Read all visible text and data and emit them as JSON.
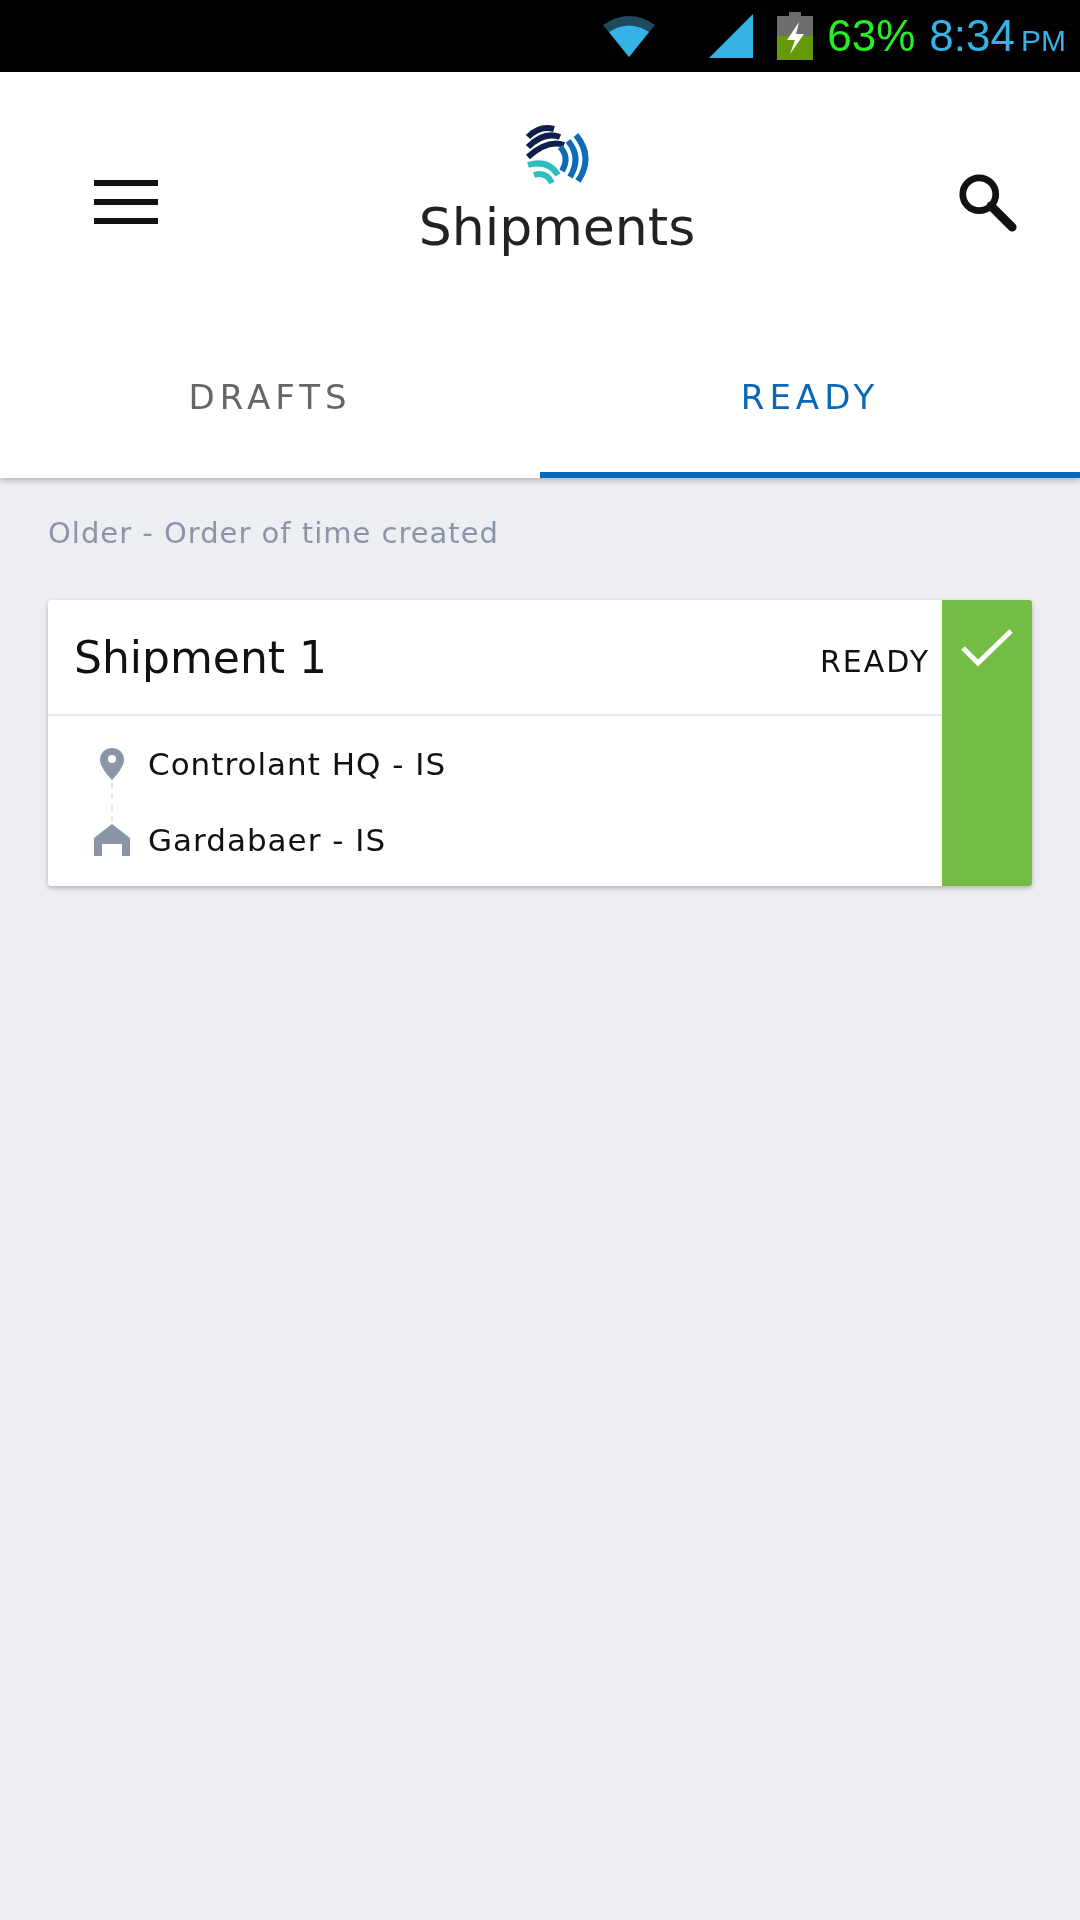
{
  "status_bar": {
    "battery": "63%",
    "time": "8:34",
    "ampm": "PM"
  },
  "app_bar": {
    "title": "Shipments"
  },
  "tabs": [
    {
      "label": "DRAFTS",
      "selected": false
    },
    {
      "label": "READY",
      "selected": true
    }
  ],
  "section_label": "Older - Order of time created",
  "shipments": [
    {
      "name": "Shipment 1",
      "status": "READY",
      "ready": true,
      "stops": [
        {
          "kind": "origin",
          "label": "Controlant HQ - IS"
        },
        {
          "kind": "destination",
          "label": "Gardabaer - IS"
        }
      ]
    }
  ]
}
